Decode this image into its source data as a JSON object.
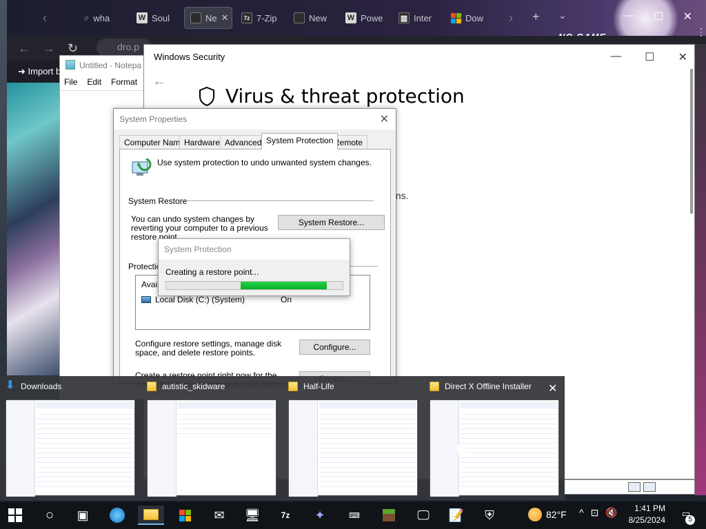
{
  "browser": {
    "tabs": [
      {
        "label": "wha",
        "icon": "search-icon"
      },
      {
        "label": "Soul",
        "icon": "W"
      },
      {
        "label": "Ne",
        "icon": "terminal-icon",
        "active": true
      },
      {
        "label": "7-Zip",
        "icon": "7z"
      },
      {
        "label": "New",
        "icon": "terminal-icon"
      },
      {
        "label": "Powe",
        "icon": "W"
      },
      {
        "label": "Inter",
        "icon": "archive-icon"
      },
      {
        "label": "Dow",
        "icon": "windows-logo-icon"
      }
    ],
    "address": "dro.p",
    "import_label": "Import b",
    "banner_text": "NO GAME"
  },
  "notepad": {
    "title": "Untitled - Notepa",
    "menu": [
      "File",
      "Edit",
      "Format"
    ]
  },
  "winsec": {
    "title": "Windows Security",
    "heading": "Virus & threat protection",
    "fragment": "ons."
  },
  "sysprops": {
    "title": "System Properties",
    "tabs": [
      "Computer Name",
      "Hardware",
      "Advanced",
      "System Protection",
      "Remote"
    ],
    "active_tab": "System Protection",
    "description": "Use system protection to undo unwanted system changes.",
    "restore_header": "System Restore",
    "restore_text": "You can undo system changes by reverting your computer to a previous restore point.",
    "restore_button": "System Restore...",
    "protection_header": "Protection",
    "list_header": "Availa",
    "drive_label": "Local Disk (C:) (System)",
    "drive_status": "On",
    "configure_text": "Configure restore settings, manage disk space, and delete restore points.",
    "configure_button": "Configure...",
    "create_text": "Create a restore point right now for the drives that have system protection turned on.",
    "create_button": "Create..."
  },
  "progress_dialog": {
    "title": "System Protection",
    "message": "Creating a restore point...",
    "progress_start": 0.42,
    "progress_end": 0.91,
    "color": "#06b025"
  },
  "taskview": {
    "windows": [
      {
        "title": "Downloads",
        "icon": "download-arrow-icon"
      },
      {
        "title": "autistic_skidware",
        "icon": "folder-icon"
      },
      {
        "title": "Half-Life",
        "icon": "folder-icon"
      },
      {
        "title": "Direct X Offline Installer",
        "icon": "folder-icon"
      }
    ]
  },
  "taskbar": {
    "weather": "82°F",
    "time": "1:41 PM",
    "date": "8/25/2024",
    "notifications": "5"
  }
}
